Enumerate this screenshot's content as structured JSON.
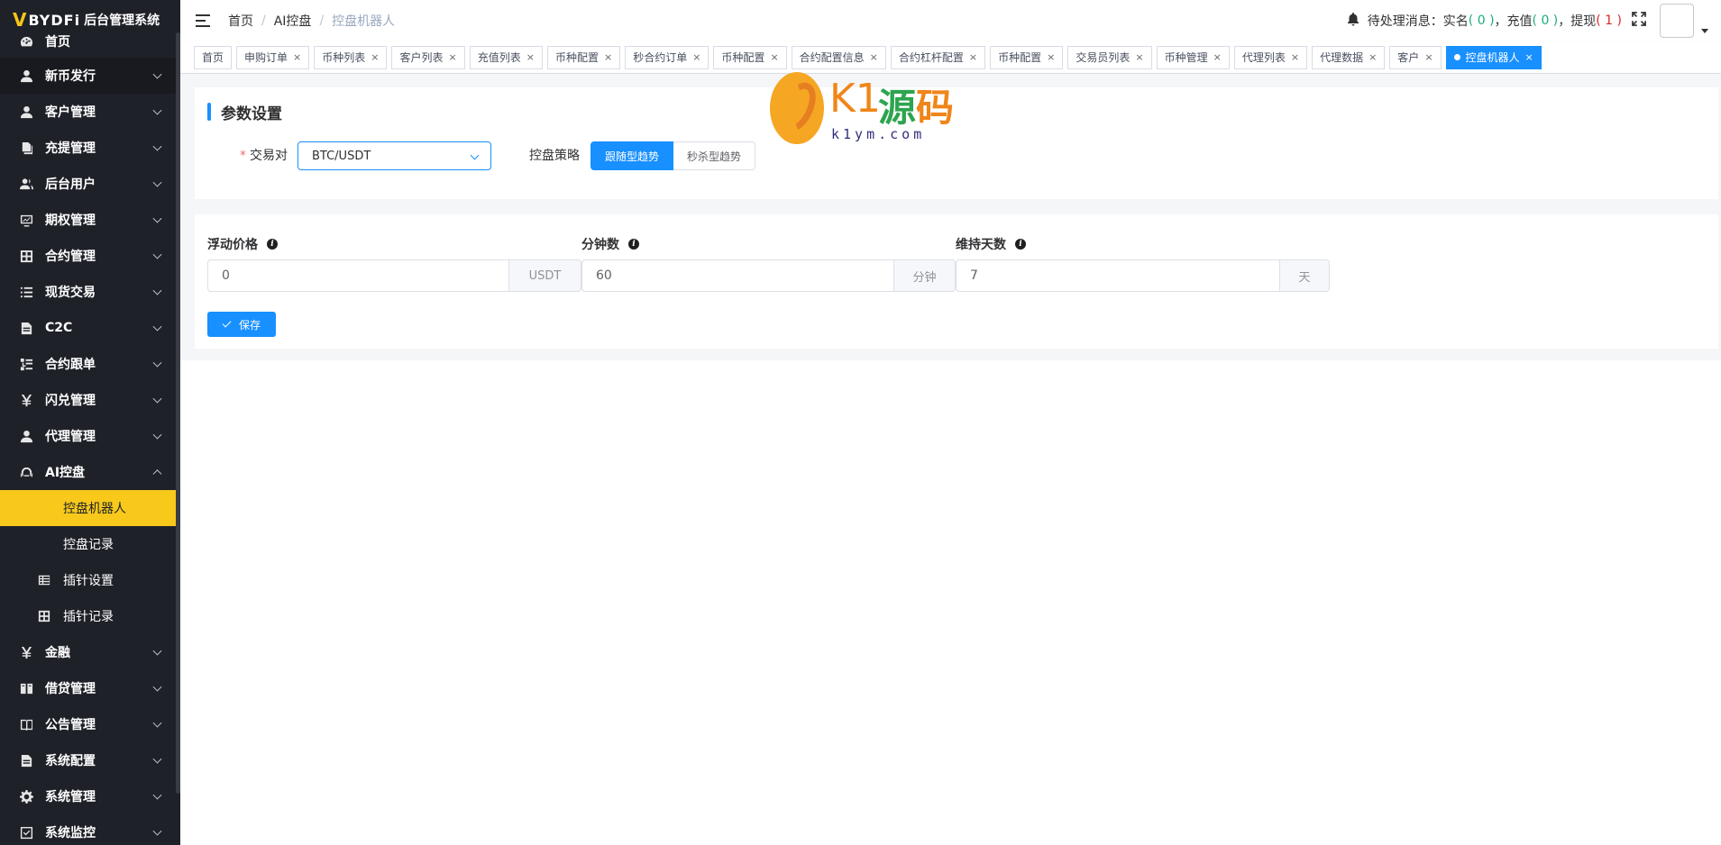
{
  "app": {
    "logo_mark": "V",
    "brand": "BYDFi",
    "title": "后台管理系统"
  },
  "sidebar": {
    "items": [
      {
        "label": "首页",
        "icon": "dashboard-icon",
        "expandable": false
      },
      {
        "label": "新币发行",
        "icon": "user-icon",
        "expandable": true
      },
      {
        "label": "客户管理",
        "icon": "user-icon",
        "expandable": true
      },
      {
        "label": "充提管理",
        "icon": "copy-icon",
        "expandable": true
      },
      {
        "label": "后台用户",
        "icon": "users-icon",
        "expandable": true
      },
      {
        "label": "期权管理",
        "icon": "monitor-icon",
        "expandable": true
      },
      {
        "label": "合约管理",
        "icon": "grid-icon",
        "expandable": true
      },
      {
        "label": "现货交易",
        "icon": "list-icon",
        "expandable": true
      },
      {
        "label": "C2C",
        "icon": "doc-icon",
        "expandable": true
      },
      {
        "label": "合约跟单",
        "icon": "list-tree-icon",
        "expandable": true
      },
      {
        "label": "闪兑管理",
        "icon": "yen-icon",
        "expandable": true
      },
      {
        "label": "代理管理",
        "icon": "user-icon",
        "expandable": true
      },
      {
        "label": "AI控盘",
        "icon": "robot-icon",
        "expandable": true,
        "expanded": true
      }
    ],
    "ai_children": [
      {
        "label": "控盘机器人",
        "active": true
      },
      {
        "label": "控盘记录",
        "active": false
      },
      {
        "label": "插针设置",
        "icon": "table-icon"
      },
      {
        "label": "插针记录",
        "icon": "grid-icon"
      }
    ],
    "items_after": [
      {
        "label": "金融",
        "icon": "yen-icon"
      },
      {
        "label": "借贷管理",
        "icon": "book-icon"
      },
      {
        "label": "公告管理",
        "icon": "book-open-icon"
      },
      {
        "label": "系统配置",
        "icon": "doc-icon"
      },
      {
        "label": "系统管理",
        "icon": "gear-icon"
      },
      {
        "label": "系统监控",
        "icon": "check-square-icon"
      }
    ]
  },
  "header": {
    "breadcrumb": [
      "首页",
      "AI控盘",
      "控盘机器人"
    ],
    "notice_prefix": "待处理消息：实名",
    "realname_count": "( 0 )",
    "recharge_label": "，充值",
    "recharge_count": "( 0 )",
    "withdraw_label": "，提现",
    "withdraw_count": "( 1 )"
  },
  "tags": [
    {
      "label": "首页",
      "closable": false
    },
    {
      "label": "申购订单",
      "closable": true
    },
    {
      "label": "币种列表",
      "closable": true
    },
    {
      "label": "客户列表",
      "closable": true
    },
    {
      "label": "充值列表",
      "closable": true
    },
    {
      "label": "币种配置",
      "closable": true
    },
    {
      "label": "秒合约订单",
      "closable": true
    },
    {
      "label": "币种配置",
      "closable": true
    },
    {
      "label": "合约配置信息",
      "closable": true
    },
    {
      "label": "合约杠杆配置",
      "closable": true
    },
    {
      "label": "币种配置",
      "closable": true
    },
    {
      "label": "交易员列表",
      "closable": true
    },
    {
      "label": "币种管理",
      "closable": true
    },
    {
      "label": "代理列表",
      "closable": true
    },
    {
      "label": "代理数据",
      "closable": true
    },
    {
      "label": "客户",
      "closable": true
    },
    {
      "label": "控盘机器人",
      "closable": true,
      "active": true
    }
  ],
  "form": {
    "section_title": "参数设置",
    "pair_label": "交易对",
    "pair_value": "BTC/USDT",
    "strategy_label": "控盘策略",
    "strategy_options": [
      "跟随型趋势",
      "秒杀型趋势"
    ],
    "strategy_selected": "跟随型趋势",
    "float_price_label": "浮动价格",
    "float_price_value": "0",
    "float_price_unit": "USDT",
    "minutes_label": "分钟数",
    "minutes_value": "60",
    "minutes_unit": "分钟",
    "days_label": "维持天数",
    "days_value": "7",
    "days_unit": "天",
    "save_label": "保存"
  },
  "watermark": {
    "text_k1": "K1",
    "text_yuan": "源",
    "text_ma": "码",
    "url": "k1ym.com"
  },
  "colors": {
    "sidebar_bg": "#1f2129",
    "active_menu": "#f8c91b",
    "primary": "#1890ff"
  }
}
